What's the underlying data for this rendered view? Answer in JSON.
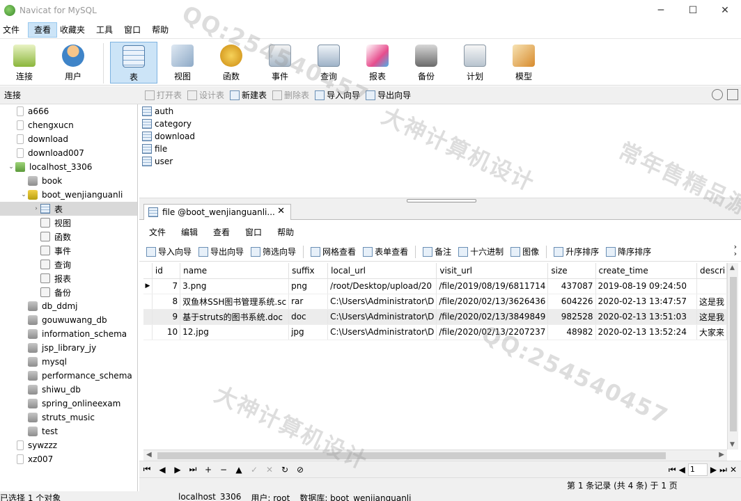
{
  "window": {
    "title": "Navicat for MySQL",
    "controls": [
      "─",
      "☐",
      "✕"
    ]
  },
  "menubar": [
    "文件",
    "查看",
    "收藏夹",
    "工具",
    "窗口",
    "帮助"
  ],
  "ribbon": [
    {
      "label": "连接",
      "icon": "connection-icon"
    },
    {
      "label": "用户",
      "icon": "user-icon"
    },
    {
      "label": "表",
      "icon": "table-icon"
    },
    {
      "label": "视图",
      "icon": "view-icon"
    },
    {
      "label": "函数",
      "icon": "function-icon"
    },
    {
      "label": "事件",
      "icon": "event-icon"
    },
    {
      "label": "查询",
      "icon": "query-icon"
    },
    {
      "label": "报表",
      "icon": "report-icon"
    },
    {
      "label": "备份",
      "icon": "backup-icon"
    },
    {
      "label": "计划",
      "icon": "schedule-icon"
    },
    {
      "label": "模型",
      "icon": "model-icon"
    }
  ],
  "ribbon_selected": "表",
  "conn_header": "连接",
  "object_toolbar": [
    "打开表",
    "设计表",
    "新建表",
    "删除表",
    "导入向导",
    "导出向导"
  ],
  "tree": [
    {
      "label": "a666",
      "type": "conn",
      "level": 0
    },
    {
      "label": "chengxucn",
      "type": "conn",
      "level": 0
    },
    {
      "label": "download",
      "type": "conn",
      "level": 0
    },
    {
      "label": "download007",
      "type": "conn",
      "level": 0
    },
    {
      "label": "localhost_3306",
      "type": "host",
      "level": 0,
      "expanded": true
    },
    {
      "label": "book",
      "type": "db",
      "level": 1
    },
    {
      "label": "boot_wenjianguanli",
      "type": "dbopen",
      "level": 1,
      "expanded": true
    },
    {
      "label": "表",
      "type": "tbl",
      "level": 2,
      "selected": true,
      "collapsed": true
    },
    {
      "label": "视图",
      "type": "gen",
      "level": 2
    },
    {
      "label": "函数",
      "type": "gen",
      "level": 2
    },
    {
      "label": "事件",
      "type": "gen",
      "level": 2
    },
    {
      "label": "查询",
      "type": "gen",
      "level": 2
    },
    {
      "label": "报表",
      "type": "gen",
      "level": 2
    },
    {
      "label": "备份",
      "type": "gen",
      "level": 2
    },
    {
      "label": "db_ddmj",
      "type": "db",
      "level": 1
    },
    {
      "label": "gouwuwang_db",
      "type": "db",
      "level": 1
    },
    {
      "label": "information_schema",
      "type": "db",
      "level": 1
    },
    {
      "label": "jsp_library_jy",
      "type": "db",
      "level": 1
    },
    {
      "label": "mysql",
      "type": "db",
      "level": 1
    },
    {
      "label": "performance_schema",
      "type": "db",
      "level": 1
    },
    {
      "label": "shiwu_db",
      "type": "db",
      "level": 1
    },
    {
      "label": "spring_onlineexam",
      "type": "db",
      "level": 1
    },
    {
      "label": "struts_music",
      "type": "db",
      "level": 1
    },
    {
      "label": "test",
      "type": "db",
      "level": 1
    },
    {
      "label": "sywzzz",
      "type": "conn",
      "level": 0
    },
    {
      "label": "xz007",
      "type": "conn",
      "level": 0
    }
  ],
  "tables": [
    "auth",
    "category",
    "download",
    "file",
    "user"
  ],
  "tab": {
    "label": "file @boot_wenjianguanli...",
    "close": "✕"
  },
  "editor_menu": [
    "文件",
    "编辑",
    "查看",
    "窗口",
    "帮助"
  ],
  "grid_toolbar": [
    "导入向导",
    "导出向导",
    "筛选向导",
    "网格查看",
    "表单查看",
    "备注",
    "十六进制",
    "图像",
    "升序排序",
    "降序排序"
  ],
  "grid": {
    "columns": [
      "id",
      "name",
      "suffix",
      "local_url",
      "visit_url",
      "size",
      "create_time",
      "descri"
    ],
    "rows": [
      [
        "7",
        "3.png",
        "png",
        "/root/Desktop/upload/20",
        "/file/2019/08/19/6811714",
        "437087",
        "2019-08-19 09:24:50",
        ""
      ],
      [
        "8",
        "双鱼林SSH图书管理系统.sc",
        "rar",
        "C:\\Users\\Administrator\\D",
        "/file/2020/02/13/3626436",
        "604226",
        "2020-02-13 13:47:57",
        "这是我"
      ],
      [
        "9",
        "基于struts的图书系统.doc",
        "doc",
        "C:\\Users\\Administrator\\D",
        "/file/2020/02/13/3849849",
        "982528",
        "2020-02-13 13:51:03",
        "这是我"
      ],
      [
        "10",
        "12.jpg",
        "jpg",
        "C:\\Users\\Administrator\\D",
        "/file/2020/02/13/2207237",
        "48982",
        "2020-02-13 13:52:24",
        "大家来"
      ]
    ]
  },
  "nav_buttons": [
    "⏮",
    "◀",
    "▶",
    "⏭",
    "+",
    "−",
    "▲",
    "✓",
    "✕",
    "↻",
    "⊘"
  ],
  "page": {
    "value": "1"
  },
  "grid_status": "第 1 条记录 (共 4 条) 于 1 页",
  "status": {
    "left": "已选择 1 个对象",
    "conn": "localhost_3306",
    "user": "用户: root",
    "db": "数据库: boot_wenjianguanli"
  },
  "watermarks": [
    "QQ:254540457",
    "大神计算机设计",
    "常年售精品源码"
  ]
}
